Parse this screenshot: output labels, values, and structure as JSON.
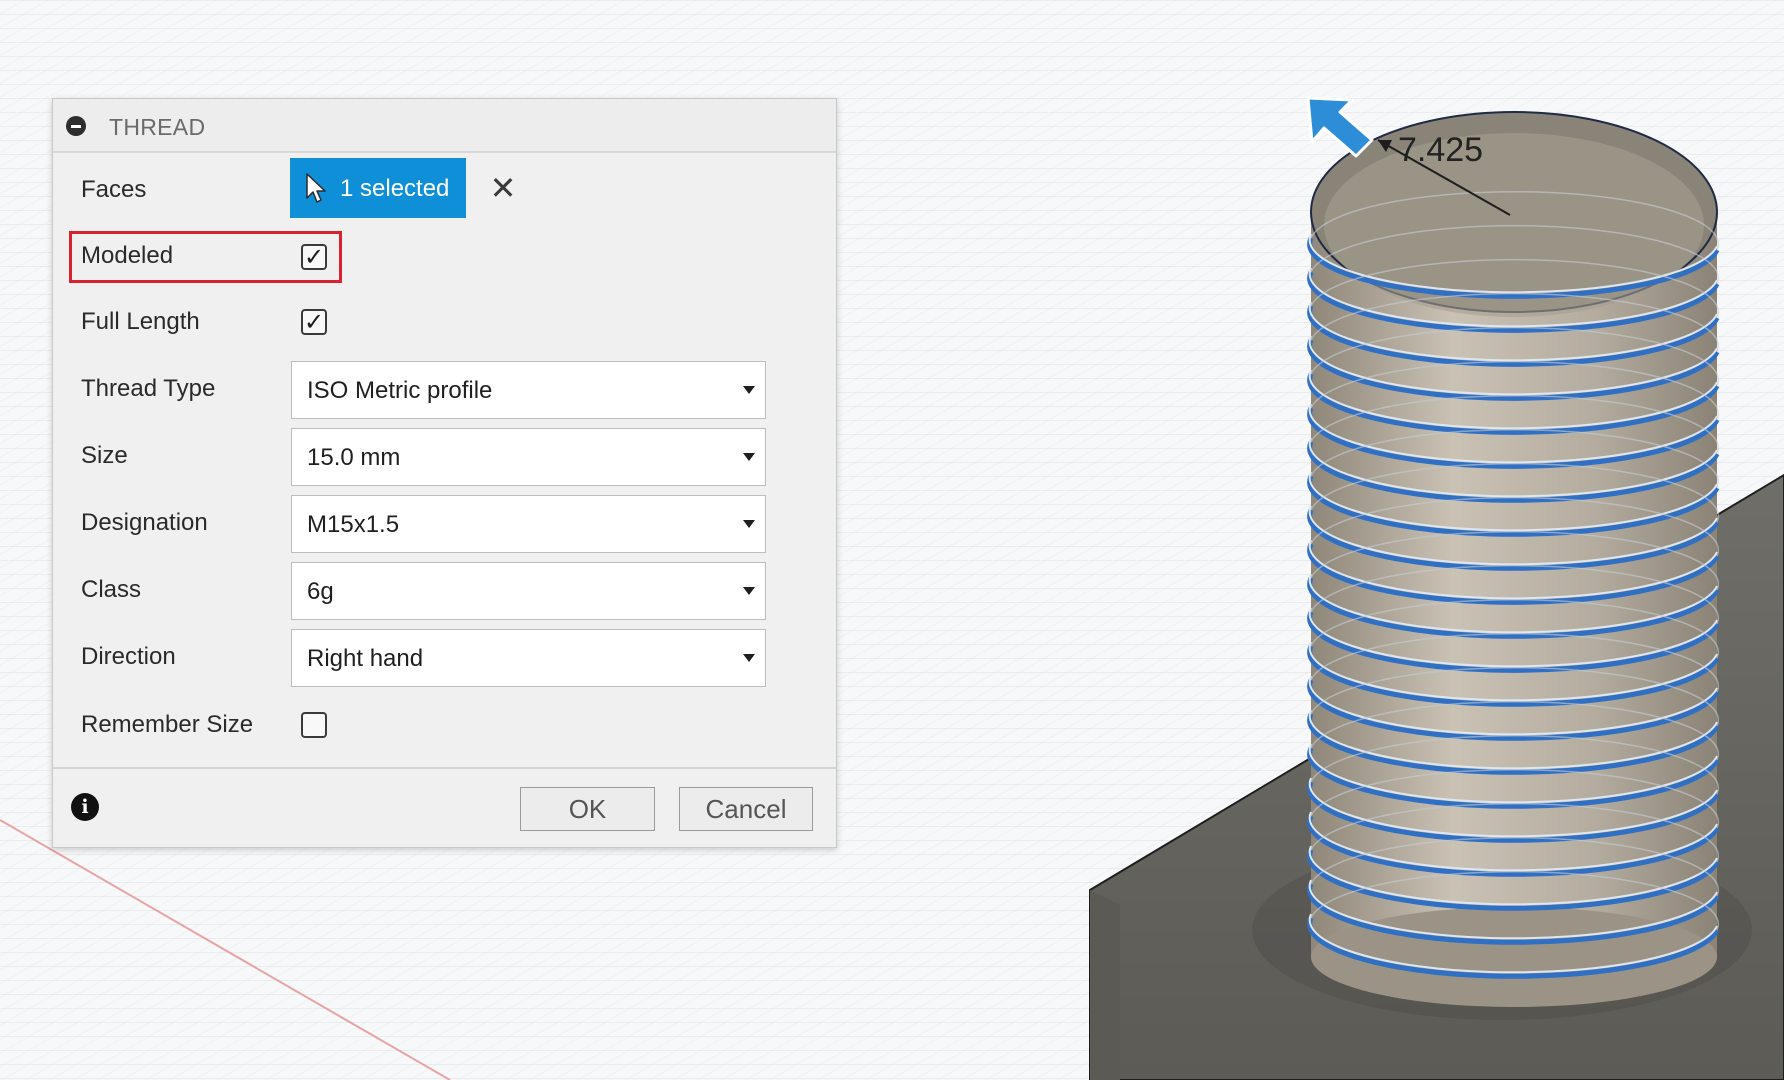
{
  "dialog": {
    "title": "THREAD",
    "faces": {
      "label": "Faces",
      "button_label": "1 selected"
    },
    "modeled": {
      "label": "Modeled",
      "checked": true
    },
    "full_length": {
      "label": "Full Length",
      "checked": true
    },
    "thread_type": {
      "label": "Thread Type",
      "value": "ISO Metric profile"
    },
    "size": {
      "label": "Size",
      "value": "15.0 mm"
    },
    "designation": {
      "label": "Designation",
      "value": "M15x1.5"
    },
    "class": {
      "label": "Class",
      "value": "6g"
    },
    "direction": {
      "label": "Direction",
      "value": "Right hand"
    },
    "remember_size": {
      "label": "Remember Size",
      "checked": false
    },
    "ok_label": "OK",
    "cancel_label": "Cancel"
  },
  "viewport": {
    "dimension_value": "7.425"
  },
  "colors": {
    "selection_blue": "#0e8fd8",
    "highlight_red": "#d8232f",
    "thread_blue": "#2f6fc4"
  }
}
